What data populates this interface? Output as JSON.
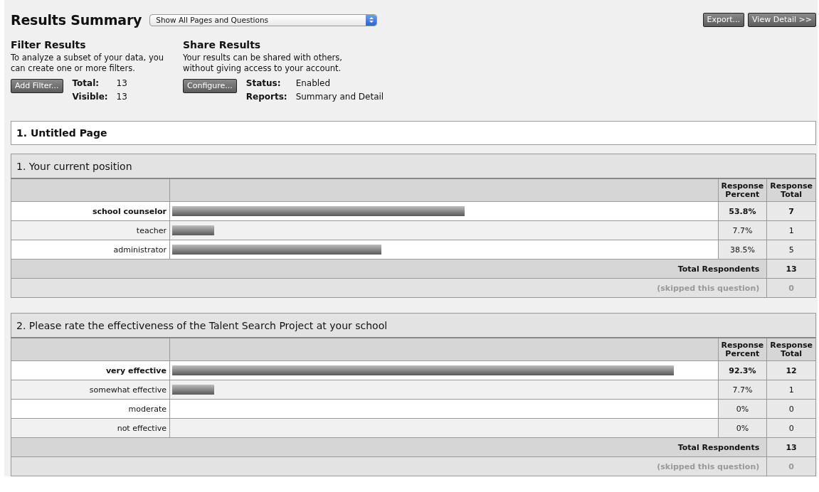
{
  "title": "Results Summary",
  "view_select": {
    "value": "Show All Pages and Questions"
  },
  "header_buttons": [
    "Export...",
    "View Detail >>"
  ],
  "filter": {
    "heading": "Filter Results",
    "description": "To analyze a subset of your data, you can create one or more filters.",
    "button": "Add Filter...",
    "stats": [
      {
        "label": "Total:",
        "value": "13"
      },
      {
        "label": "Visible:",
        "value": "13"
      }
    ]
  },
  "share": {
    "heading": "Share Results",
    "description": "Your results can be shared with others, without giving access to your account.",
    "button": "Configure...",
    "stats": [
      {
        "label": "Status:",
        "value": "Enabled"
      },
      {
        "label": "Reports:",
        "value": "Summary and Detail"
      }
    ]
  },
  "page_title": "1. Untitled Page",
  "questions": [
    {
      "title": "1. Your current position",
      "columns": [
        "Response Percent",
        "Response Total"
      ],
      "rows": [
        {
          "label": "school counselor",
          "level": 0.538,
          "percent": "53.8%",
          "total": "7",
          "top": true
        },
        {
          "label": "teacher",
          "level": 0.077,
          "percent": "7.7%",
          "total": "1",
          "top": false
        },
        {
          "label": "administrator",
          "level": 0.385,
          "percent": "38.5%",
          "total": "5",
          "top": false
        }
      ],
      "total_label": "Total Respondents",
      "total_value": "13",
      "skipped_label": "(skipped this question)",
      "skipped_value": "0"
    },
    {
      "title": "2. Please rate the effectiveness of the Talent Search Project at your school",
      "columns": [
        "Response Percent",
        "Response Total"
      ],
      "rows": [
        {
          "label": "very effective",
          "level": 0.923,
          "percent": "92.3%",
          "total": "12",
          "top": true
        },
        {
          "label": "somewhat effective",
          "level": 0.077,
          "percent": "7.7%",
          "total": "1",
          "top": false
        },
        {
          "label": "moderate",
          "percent": "0%",
          "total": "0",
          "top": false
        },
        {
          "label": "not effective",
          "percent": "0%",
          "total": "0",
          "top": false
        }
      ],
      "total_label": "Total Respondents",
      "total_value": "13",
      "skipped_label": "(skipped this question)",
      "skipped_value": "0"
    }
  ]
}
